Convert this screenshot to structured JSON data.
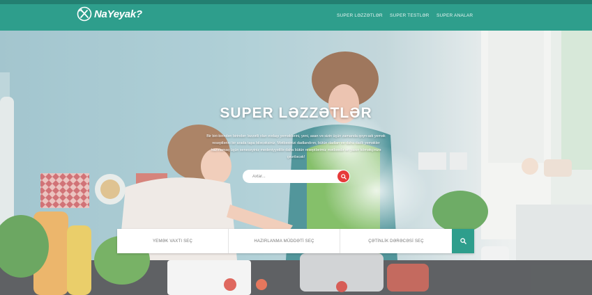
{
  "brand": {
    "name": "NaYeyak?",
    "accent": "#2e9e8c",
    "search_button_color": "#e63a3a"
  },
  "nav": {
    "items": [
      {
        "label": "SUPER LƏZZƏTLƏR"
      },
      {
        "label": "SUPER TESTLƏR"
      },
      {
        "label": "SUPER ANALAR"
      }
    ]
  },
  "hero": {
    "title": "SUPER LƏZZƏTLƏR",
    "description": "Bir biri-birindən birindən ləzzətli olan evdaşı yeməklərini, yeni, asan və sizin üçün zamanda qoyn-adı yemək reseptlərini bir arada tapa biləcəksiniz. Mətbəxinizi dadlandırın, bütün dadları ve daha dadlı yeməkler hazırlamaq üçün seneceyiniz medeniyyətlilə daha bütün reseptlərimiz mətbəxdə ən yaxın köməkçinizə çevriləcək!",
    "search": {
      "placeholder": "Axtar...",
      "icon": "search-icon"
    }
  },
  "filters": {
    "items": [
      {
        "label": "YEMƏK VAXTI SEÇ"
      },
      {
        "label": "HAZIRLANMA MÜDDƏTİ SEÇ"
      },
      {
        "label": "ÇƏTİNLİK DƏRƏCƏSİ SEÇ"
      }
    ],
    "button_icon": "search-icon"
  }
}
